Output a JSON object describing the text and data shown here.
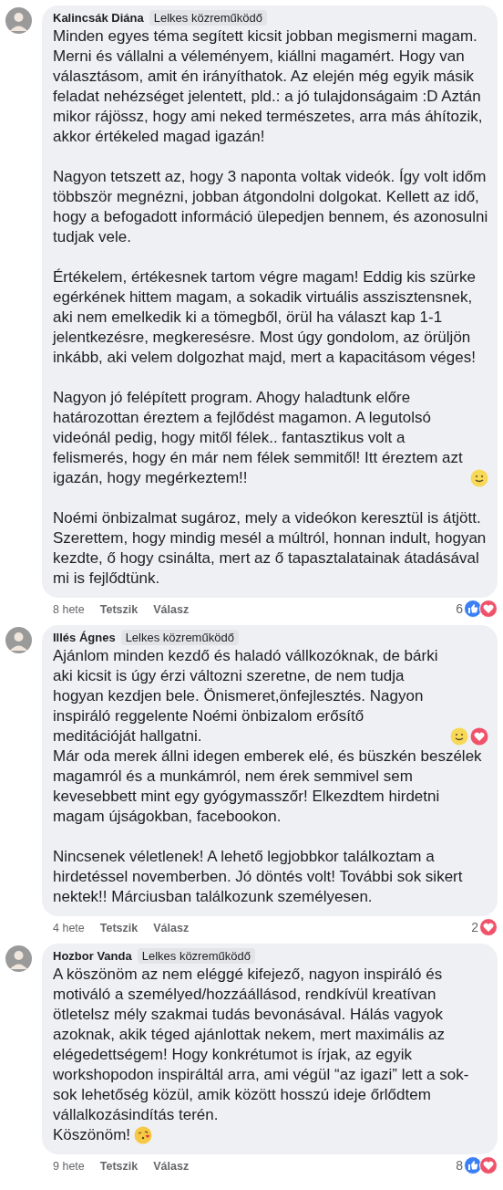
{
  "comments": [
    {
      "author": "Kalincsák Diána",
      "badge": "Lelkes közreműködő",
      "paragraphs": [
        [
          {
            "text": "Minden egyes téma segített kicsit jobban megismerni magam. Merni és vállalni a véleményem, kiállni magamért. Hogy van választásom, amit én irányíthatok. Az elején még egyik másik feladat nehézséget jelentett, pld.: a jó tulajdonságaim :D Aztán mikor rájössz, hogy ami neked természetes, arra más áhítozik, akkor értékeled magad igazán!"
          }
        ],
        [
          {
            "text": "Nagyon tetszett az, hogy 3 naponta voltak videók. Így volt időm többször megnézni, jobban átgondolni dolgokat. Kellett az idő, hogy a befogadott információ ülepedjen bennem, és azonosulni tudjak vele."
          }
        ],
        [
          {
            "text": "Értékelem, értékesnek tartom végre magam! Eddig kis szürke egérkének hittem magam, a sokadik virtuális asszisztensnek, aki nem emelkedik ki a tömegből, örül ha választ kap 1-1 jelentkezésre, megkeresésre. Most úgy gondolom, az örüljön inkább, aki velem dolgozhat majd, mert a kapacitásom véges!"
          }
        ],
        [
          {
            "text": "Nagyon jó felépített program. Ahogy haladtunk előre határozottan éreztem a fejlődést magamon. A legutolsó videónál pedig, hogy mitől félek.. fantasztikus volt a felismerés, hogy én már nem félek semmitől! Itt éreztem azt igazán, hogy megérkeztem!!",
            "emojis": [
              {
                "kind": "smile"
              }
            ]
          }
        ],
        [
          {
            "text": "Noémi önbizalmat sugároz, mely a videókon keresztül is átjött. Szerettem, hogy mindig mesél a múltról, honnan indult, hogyan kezdte, ő hogy csinálta, mert az ő tapasztalatainak átadásával mi is fejlődtünk."
          }
        ]
      ],
      "time": "8 hete",
      "like": "Tetszik",
      "reply": "Válasz",
      "reaction_count": "6",
      "reactions": [
        {
          "kind": "like"
        },
        {
          "kind": "heart"
        }
      ]
    },
    {
      "author": "Illés Ágnes",
      "badge": "Lelkes közreműködő",
      "paragraphs": [
        [
          {
            "text": "Ajánlom minden kezdő és haladó vállkozóknak, de bárki aki kicsit is úgy érzi változni szeretne, de nem tudja hogyan kezdjen bele. Önismeret,önfejlesztés. Nagyon inspiráló reggelente Noémi önbizalom erősítő meditációját hallgatni.",
            "emojis": [
              {
                "kind": "smile"
              },
              {
                "kind": "heart"
              }
            ]
          },
          {
            "text": "Már oda merek állni idegen emberek elé, és büszkén beszélek magamról és a munkámról, nem érek semmivel sem kevesebbett mint egy gyógymasszőr! Elkezdtem hirdetni magam újságokban, facebookon."
          }
        ],
        [
          {
            "text": "Nincsenek véletlenek! A lehető legjobbkor találkoztam a hirdetéssel novemberben. Jó döntés volt! További sok sikert nektek!! Márciusban találkozunk személyesen."
          }
        ]
      ],
      "time": "4 hete",
      "like": "Tetszik",
      "reply": "Válasz",
      "reaction_count": "2",
      "reactions": [
        {
          "kind": "heart"
        }
      ]
    },
    {
      "author": "Hozbor Vanda",
      "badge": "Lelkes közreműködő",
      "paragraphs": [
        [
          {
            "text": "A köszönöm az nem eléggé kifejező, nagyon inspiráló és motiváló a személyed/hozzáállásod, rendkívül kreatívan ötletelsz mély szakmai tudás bevonásával. Hálás vagyok azoknak, akik téged ajánlottak nekem, mert maximális az elégedettségem! Hogy konkrétumot is írjak, az egyik workshopodon inspiráltál arra, ami végül “az igazi” lett a sok-sok lehetőség közül, amik között hosszú ideje őrlődtem vállalkozásindítás terén."
          },
          {
            "text": "Köszönöm!",
            "emojis": [
              {
                "kind": "kiss"
              }
            ]
          }
        ]
      ],
      "time": "9 hete",
      "like": "Tetszik",
      "reply": "Válasz",
      "reaction_count": "8",
      "reactions": [
        {
          "kind": "like"
        },
        {
          "kind": "heart"
        }
      ]
    }
  ]
}
